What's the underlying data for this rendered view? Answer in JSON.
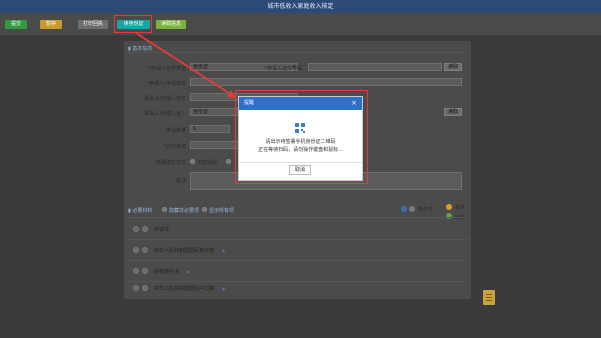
{
  "window": {
    "title": "城市低收入家庭收入核定"
  },
  "toolbar": {
    "buttons": [
      {
        "label": "提交",
        "color": "#2f9b3e"
      },
      {
        "label": "暂存",
        "color": "#c89a2b"
      },
      {
        "label": "打印回执",
        "color": "#6d6d6d"
      },
      {
        "label": "读身份证",
        "color": "#17a6a6"
      },
      {
        "label": "读取信息",
        "color": "#7ab43b"
      }
    ]
  },
  "basic_info": {
    "section_title": "基本信息",
    "id_type_label": "*申请人证件类型",
    "id_type_value": "身份证",
    "id_number_label": "*申请人证件号码",
    "read_button": "读取",
    "unit_label": "*申请人/申请单位",
    "contact_name_label": "联系人/代理人姓名",
    "contact_id_type_label": "联系人/代理人证···",
    "contact_id_type_value": "身份证",
    "read_button2": "读取",
    "quantity_label": "申请数量",
    "quantity_value": "1",
    "item_name_label": "*办件名称",
    "result_delivery_label": "结果送达方式",
    "result_delivery_option": "无需收取",
    "remark_label": "备注"
  },
  "materials": {
    "section_title": "必要材料",
    "toggle_required": "隐藏非必要项",
    "toggle_legend": "显示所有项",
    "legend": [
      {
        "label": "电子件",
        "color": "#3e6fb0"
      },
      {
        "label": "纸件",
        "color": "#d6a21d"
      },
      {
        "label": "缺件",
        "color": "#5aa641"
      }
    ],
    "items": [
      {
        "label": "申请书",
        "note": ""
      },
      {
        "label": "中华人民共和国居民身份证",
        "note": "◆"
      },
      {
        "label": "授权委托书",
        "note": "◆"
      },
      {
        "label": "中华人民共和国居民户口簿",
        "note": "◆"
      }
    ]
  },
  "dialog": {
    "title": "提醒",
    "message_line1": "请出示待签署手机身份证二维码",
    "message_line2": "正在等待扫码，请勿操作键盘和鼠标...",
    "cancel_label": "取消",
    "close_symbol": "×"
  }
}
